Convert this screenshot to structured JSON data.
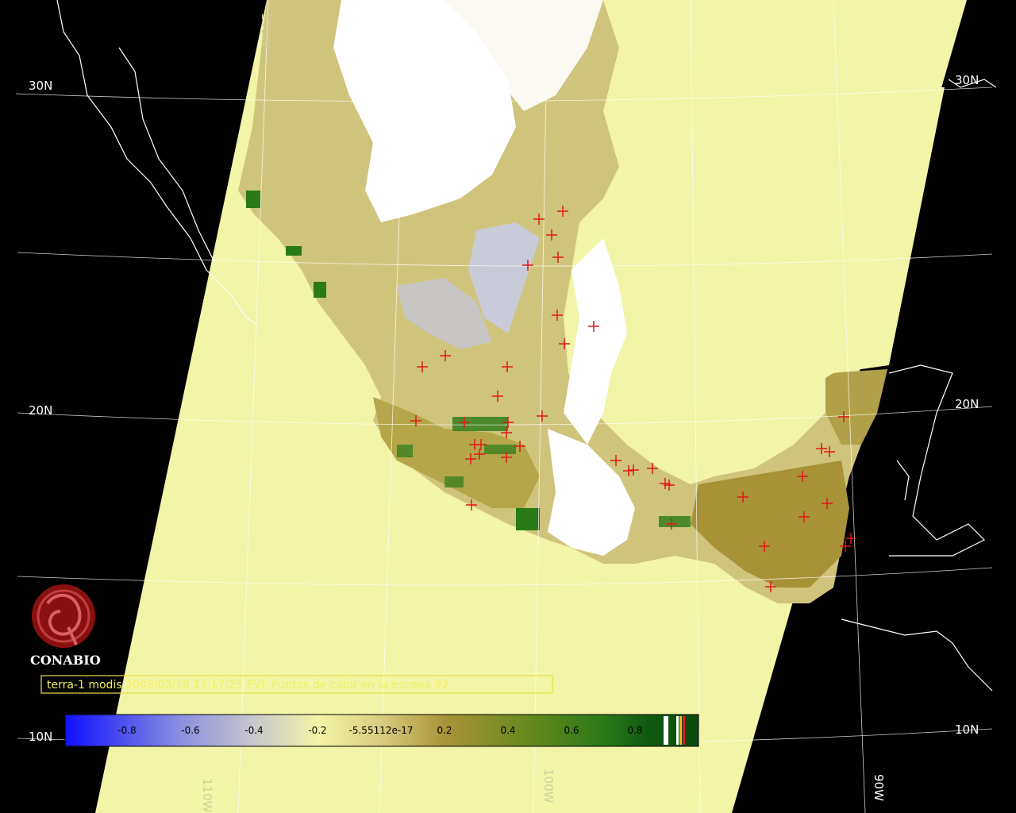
{
  "caption": "terra-1 modis 2008/03/18 17:17:25 EVI. Puntos de calor en la escena 92",
  "logo": {
    "name": "CONABIO",
    "icon": "conabio-seal-icon"
  },
  "graticule": {
    "lat_labels": [
      "30N",
      "30N",
      "20N",
      "20N",
      "10N",
      "10N"
    ],
    "lon_labels": [
      "110W",
      "110W",
      "100W",
      "90W"
    ]
  },
  "colorbar": {
    "ticks": [
      "-0.8",
      "-0.6",
      "-0.4",
      "-0.2",
      "-5.55112e-17",
      "0.2",
      "0.4",
      "0.6",
      "0.8"
    ],
    "colors": {
      "low": "#1010ff",
      "mid_low": "#b0b4d0",
      "mid": "#f2f2a0",
      "mid_high": "#b09a40",
      "high": "#1a6a1a"
    }
  },
  "colors": {
    "background": "#000000",
    "swath": "#f2f4a8",
    "hotspot": "#e01818",
    "caption_box": "#e8e040"
  },
  "hotspots": [
    [
      679,
      276
    ],
    [
      709,
      266
    ],
    [
      695,
      296
    ],
    [
      703,
      324
    ],
    [
      665,
      334
    ],
    [
      702,
      397
    ],
    [
      711,
      433
    ],
    [
      748,
      411
    ],
    [
      532,
      462
    ],
    [
      561,
      448
    ],
    [
      639,
      462
    ],
    [
      627,
      499
    ],
    [
      683,
      524
    ],
    [
      524,
      530
    ],
    [
      585,
      532
    ],
    [
      640,
      532
    ],
    [
      638,
      545
    ],
    [
      598,
      560
    ],
    [
      606,
      560
    ],
    [
      593,
      578
    ],
    [
      604,
      572
    ],
    [
      655,
      562
    ],
    [
      638,
      576
    ],
    [
      594,
      636
    ],
    [
      776,
      580
    ],
    [
      792,
      593
    ],
    [
      798,
      592
    ],
    [
      822,
      590
    ],
    [
      838,
      609
    ],
    [
      843,
      611
    ],
    [
      846,
      660
    ],
    [
      936,
      626
    ],
    [
      963,
      688
    ],
    [
      971,
      739
    ],
    [
      1011,
      600
    ],
    [
      1013,
      651
    ],
    [
      1035,
      565
    ],
    [
      1045,
      569
    ],
    [
      1042,
      634
    ],
    [
      1063,
      525
    ],
    [
      1065,
      688
    ],
    [
      1072,
      678
    ]
  ]
}
